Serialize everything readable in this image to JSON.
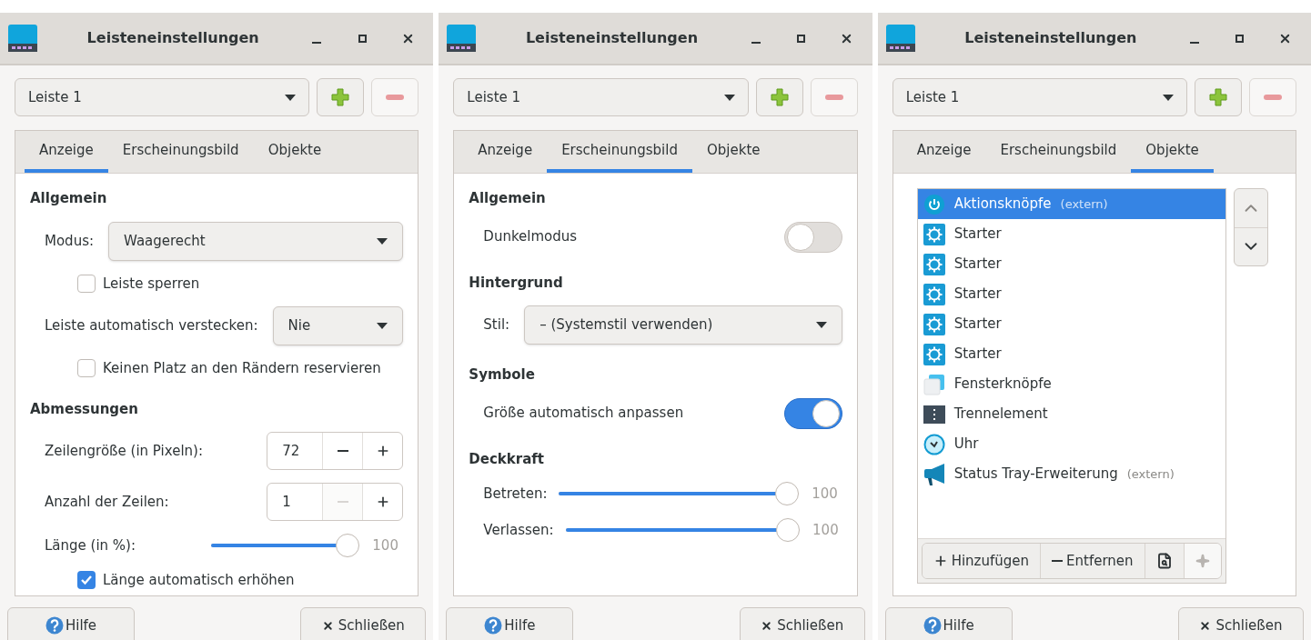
{
  "windows": [
    {
      "title": "Leisteneinstellungen",
      "panel": "Leiste 1",
      "tabs": [
        {
          "label": "Anzeige",
          "selected": true
        },
        {
          "label": "Erscheinungsbild",
          "selected": false
        },
        {
          "label": "Objekte",
          "selected": false
        }
      ],
      "page": {
        "kind": "settings",
        "sections": [
          {
            "heading": "Allgemein",
            "rows": [
              {
                "kind": "dropdown",
                "label": "Modus:",
                "value": "Waagerecht"
              },
              {
                "kind": "checkbox",
                "label": "Leiste sperren",
                "checked": false
              },
              {
                "kind": "dropdown",
                "label": "Leiste automatisch verstecken:",
                "value": "Nie"
              },
              {
                "kind": "checkbox",
                "label": "Keinen Platz an den Rändern reservieren",
                "checked": false
              }
            ]
          },
          {
            "heading": "Abmessungen",
            "rows": [
              {
                "kind": "spin",
                "label": "Zeilengröße (in Pixeln):",
                "value": "72",
                "decrement_disabled": false
              },
              {
                "kind": "spin",
                "label": "Anzahl der Zeilen:",
                "value": "1",
                "decrement_disabled": true
              },
              {
                "kind": "slider",
                "label": "Länge (in %):",
                "level": 1,
                "reading": "100",
                "short": true
              },
              {
                "kind": "checkbox",
                "label": "Länge automatisch erhöhen",
                "checked": true
              }
            ]
          }
        ]
      },
      "help": "Hilfe",
      "close": "Schließen"
    },
    {
      "title": "Leisteneinstellungen",
      "panel": "Leiste 1",
      "tabs": [
        {
          "label": "Anzeige",
          "selected": false
        },
        {
          "label": "Erscheinungsbild",
          "selected": true
        },
        {
          "label": "Objekte",
          "selected": false
        }
      ],
      "page": {
        "kind": "settings",
        "sections": [
          {
            "heading": "Allgemein",
            "rows": [
              {
                "kind": "toggle",
                "label": "Dunkelmodus",
                "on": false
              }
            ]
          },
          {
            "heading": "Hintergrund",
            "rows": [
              {
                "kind": "dropdown",
                "label": "Stil:",
                "value": "– (Systemstil verwenden)"
              }
            ]
          },
          {
            "heading": "Symbole",
            "rows": [
              {
                "kind": "toggle",
                "label": "Größe automatisch anpassen",
                "on": true
              }
            ]
          },
          {
            "heading": "Deckkraft",
            "rows": [
              {
                "kind": "slider",
                "label": "Betreten:",
                "level": 1,
                "reading": "100",
                "short": false
              },
              {
                "kind": "slider",
                "label": "Verlassen:",
                "level": 1,
                "reading": "100",
                "short": false
              }
            ]
          }
        ]
      },
      "help": "Hilfe",
      "close": "Schließen"
    },
    {
      "title": "Leisteneinstellungen",
      "panel": "Leiste 1",
      "tabs": [
        {
          "label": "Anzeige",
          "selected": false
        },
        {
          "label": "Erscheinungsbild",
          "selected": false
        },
        {
          "label": "Objekte",
          "selected": true
        }
      ],
      "page": {
        "kind": "items",
        "items": [
          {
            "kind": "actions",
            "name": "Aktionsknöpfe",
            "note": "(extern)",
            "selected": true
          },
          {
            "kind": "launcher",
            "name": "Starter",
            "selected": false
          },
          {
            "kind": "launcher",
            "name": "Starter",
            "selected": false
          },
          {
            "kind": "launcher",
            "name": "Starter",
            "selected": false
          },
          {
            "kind": "launcher",
            "name": "Starter",
            "selected": false
          },
          {
            "kind": "launcher",
            "name": "Starter",
            "selected": false
          },
          {
            "kind": "windowbuttons",
            "name": "Fensterknöpfe",
            "selected": false
          },
          {
            "kind": "separator",
            "name": "Trennelement",
            "selected": false
          },
          {
            "kind": "clock",
            "name": "Uhr",
            "selected": false
          },
          {
            "kind": "tray",
            "name": "Status Tray-Erweiterung",
            "note": "(extern)",
            "selected": false
          }
        ],
        "toolbar": [
          {
            "kind": "add",
            "label": "Hinzufügen",
            "disabled": false
          },
          {
            "kind": "remove",
            "label": "Entfernen",
            "disabled": false
          },
          {
            "kind": "about",
            "disabled": false
          },
          {
            "kind": "preferences",
            "disabled": true
          }
        ]
      },
      "help": "Hilfe",
      "close": "Schließen"
    }
  ]
}
